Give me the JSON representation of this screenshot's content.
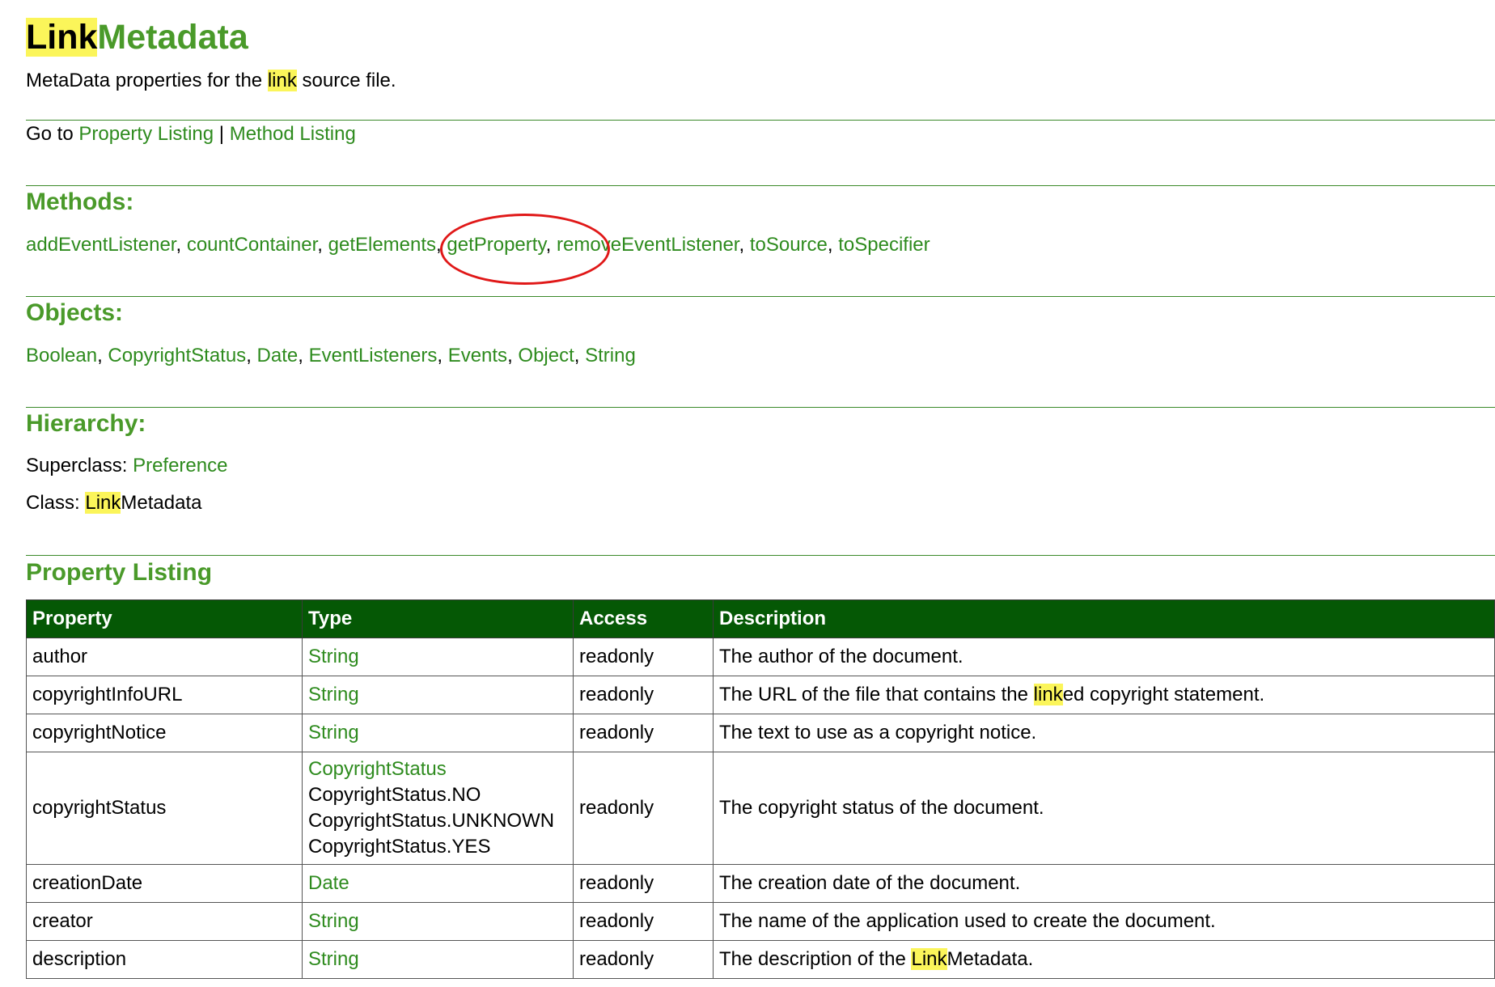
{
  "title": {
    "highlight": "Link",
    "rest": "Metadata"
  },
  "subtitle": {
    "before": "MetaData properties for the ",
    "highlight": "link",
    "after": " source file."
  },
  "goto": {
    "prefix": "Go to ",
    "property_link": "Property Listing",
    "separator": " | ",
    "method_link": "Method Listing"
  },
  "methods": {
    "heading": "Methods:",
    "items": [
      "addEventListener",
      "countContainer",
      "getElements",
      "getProperty",
      "removeEventListener",
      "toSource",
      "toSpecifier"
    ]
  },
  "objects": {
    "heading": "Objects:",
    "items": [
      "Boolean",
      "CopyrightStatus",
      "Date",
      "EventListeners",
      "Events",
      "Object",
      "String"
    ]
  },
  "hierarchy": {
    "heading": "Hierarchy:",
    "superclass_label": "Superclass: ",
    "superclass_link": "Preference",
    "class_label": "Class: ",
    "class_highlight": "Link",
    "class_rest": "Metadata"
  },
  "property_listing": {
    "heading": "Property Listing",
    "columns": [
      "Property",
      "Type",
      "Access",
      "Description"
    ],
    "rows": [
      {
        "property": "author",
        "type": "String",
        "access": "readonly",
        "desc_before": "The author of the document.",
        "desc_highlight": "",
        "desc_after": ""
      },
      {
        "property": "copyrightInfoURL",
        "type": "String",
        "access": "readonly",
        "desc_before": "The URL of the file that contains the ",
        "desc_highlight": "link",
        "desc_after": "ed copyright statement."
      },
      {
        "property": "copyrightNotice",
        "type": "String",
        "access": "readonly",
        "desc_before": "The text to use as a copyright notice.",
        "desc_highlight": "",
        "desc_after": ""
      },
      {
        "property": "copyrightStatus",
        "type": "CopyrightStatus",
        "type_values": [
          "CopyrightStatus.NO",
          "CopyrightStatus.UNKNOWN",
          "CopyrightStatus.YES"
        ],
        "access": "readonly",
        "desc_before": "The copyright status of the document.",
        "desc_highlight": "",
        "desc_after": ""
      },
      {
        "property": "creationDate",
        "type": "Date",
        "access": "readonly",
        "desc_before": "The creation date of the document.",
        "desc_highlight": "",
        "desc_after": ""
      },
      {
        "property": "creator",
        "type": "String",
        "access": "readonly",
        "desc_before": "The name of the application used to create the document.",
        "desc_highlight": "",
        "desc_after": ""
      },
      {
        "property": "description",
        "type": "String",
        "access": "readonly",
        "desc_before": "The description of the ",
        "desc_highlight": "Link",
        "desc_after": "Metadata."
      }
    ]
  },
  "colors": {
    "link": "#2e8b1e",
    "heading": "#4a9a2a",
    "table_header_bg": "#055805",
    "highlight": "#fbf55a",
    "annotation_circle": "#e01818"
  }
}
